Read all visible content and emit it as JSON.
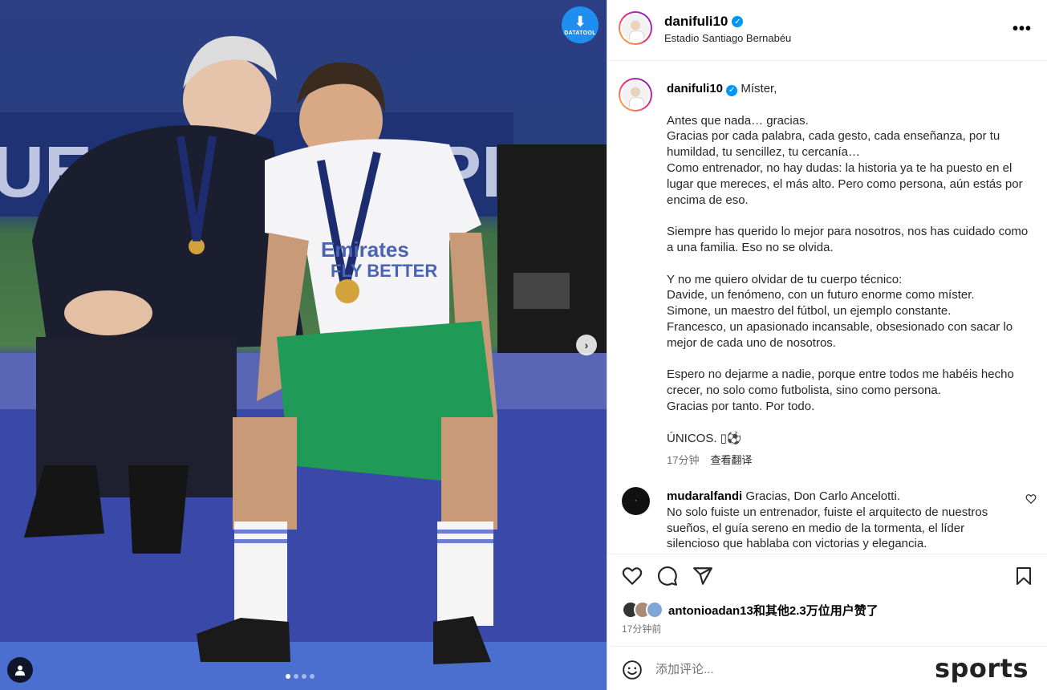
{
  "post": {
    "username": "danifuli10",
    "location": "Estadio Santiago Bernabéu",
    "download_label": "DATATOOL"
  },
  "caption": {
    "username": "danifuli10",
    "opening": "Míster,",
    "paragraphs": [
      "Antes que nada… gracias.\nGracias por cada palabra, cada gesto, cada enseñanza, por tu humildad, tu sencillez, tu cercanía…\nComo entrenador, no hay dudas: la historia ya te ha puesto en el lugar que mereces, el más alto. Pero como persona, aún estás por encima de eso.",
      "Siempre has querido lo mejor para nosotros, nos has cuidado como a una familia. Eso no se olvida.",
      "Y no me quiero olvidar de tu cuerpo técnico:\nDavide, un fenómeno, con un futuro enorme como míster.\nSimone, un maestro del fútbol, un ejemplo constante.\nFrancesco, un apasionado incansable, obsesionado con sacar lo mejor de cada uno de nosotros.",
      "Espero no dejarme a nadie, porque entre todos me habéis hecho crecer, no solo como futbolista, sino como persona.\nGracias por tanto. Por todo.",
      "ÚNICOS. ▯⚽"
    ],
    "time": "17分钟",
    "translate": "查看翻译"
  },
  "comment": {
    "username": "mudaralfandi",
    "text": "Gracias, Don Carlo Ancelotti.\nNo solo fuiste un entrenador, fuiste el arquitecto de nuestros sueños, el guía sereno en medio de la tormenta, el líder silencioso que hablaba con victorias y elegancia."
  },
  "likes": {
    "text": "antonioadan13和其他2.3万位用户赞了"
  },
  "timestamp": "17分钟前",
  "comment_box": {
    "placeholder": "添加评论..."
  },
  "watermark": "sports",
  "carousel": {
    "current": 1,
    "total": 4
  },
  "icons": [
    "download-icon",
    "chevron-right-icon",
    "user-tag-icon",
    "verified-icon",
    "more-icon",
    "heart-icon",
    "comment-icon",
    "share-icon",
    "bookmark-icon",
    "emoji-icon"
  ],
  "colors": {
    "verified": "#0095f6",
    "download_button": "#1f8ef1",
    "muted_text": "#737373"
  }
}
